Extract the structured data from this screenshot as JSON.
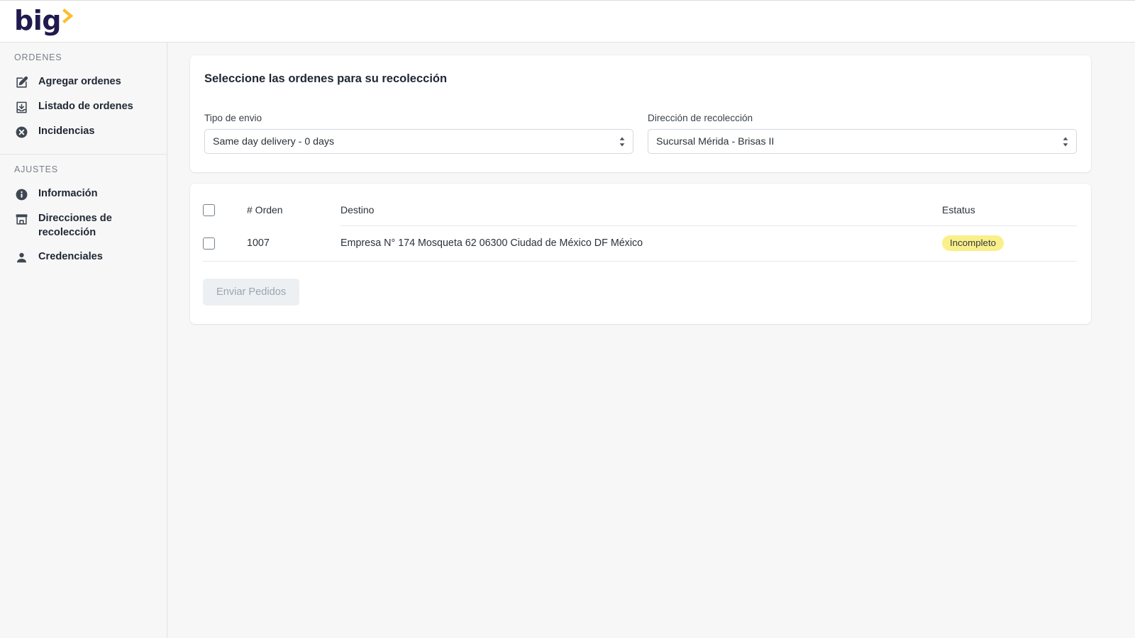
{
  "header": {
    "logo_text": "big",
    "logo_icon": "chevron-right-icon",
    "logo_color": "#201a4e",
    "logo_accent_color": "#fdbe2a"
  },
  "sidebar": {
    "groups": [
      {
        "title": "ORDENES",
        "items": [
          {
            "label": "Agregar ordenes",
            "icon": "edit-square-icon"
          },
          {
            "label": "Listado de ordenes",
            "icon": "inbox-download-icon"
          },
          {
            "label": "Incidencias",
            "icon": "x-circle-icon"
          }
        ]
      },
      {
        "title": "AJUSTES",
        "items": [
          {
            "label": "Información",
            "icon": "info-circle-icon"
          },
          {
            "label": "Direcciones de recolección",
            "icon": "storefront-icon"
          },
          {
            "label": "Credenciales",
            "icon": "user-icon"
          }
        ]
      }
    ]
  },
  "selection_card": {
    "title": "Seleccione las ordenes para su recolección",
    "shipping_type": {
      "label": "Tipo de envio",
      "value": "Same day delivery - 0 days"
    },
    "pickup_address": {
      "label": "Dirección de recolección",
      "value": "Sucursal Mérida - Brisas II"
    }
  },
  "orders_table": {
    "columns": {
      "select": "",
      "order": "# Orden",
      "destination": "Destino",
      "status": "Estatus"
    },
    "rows": [
      {
        "order": "1007",
        "destination": "Empresa N° 174 Mosqueta 62 06300 Ciudad de México DF México",
        "status": "Incompleto",
        "status_color": "#faf08a"
      }
    ],
    "submit_label": "Enviar Pedidos"
  }
}
